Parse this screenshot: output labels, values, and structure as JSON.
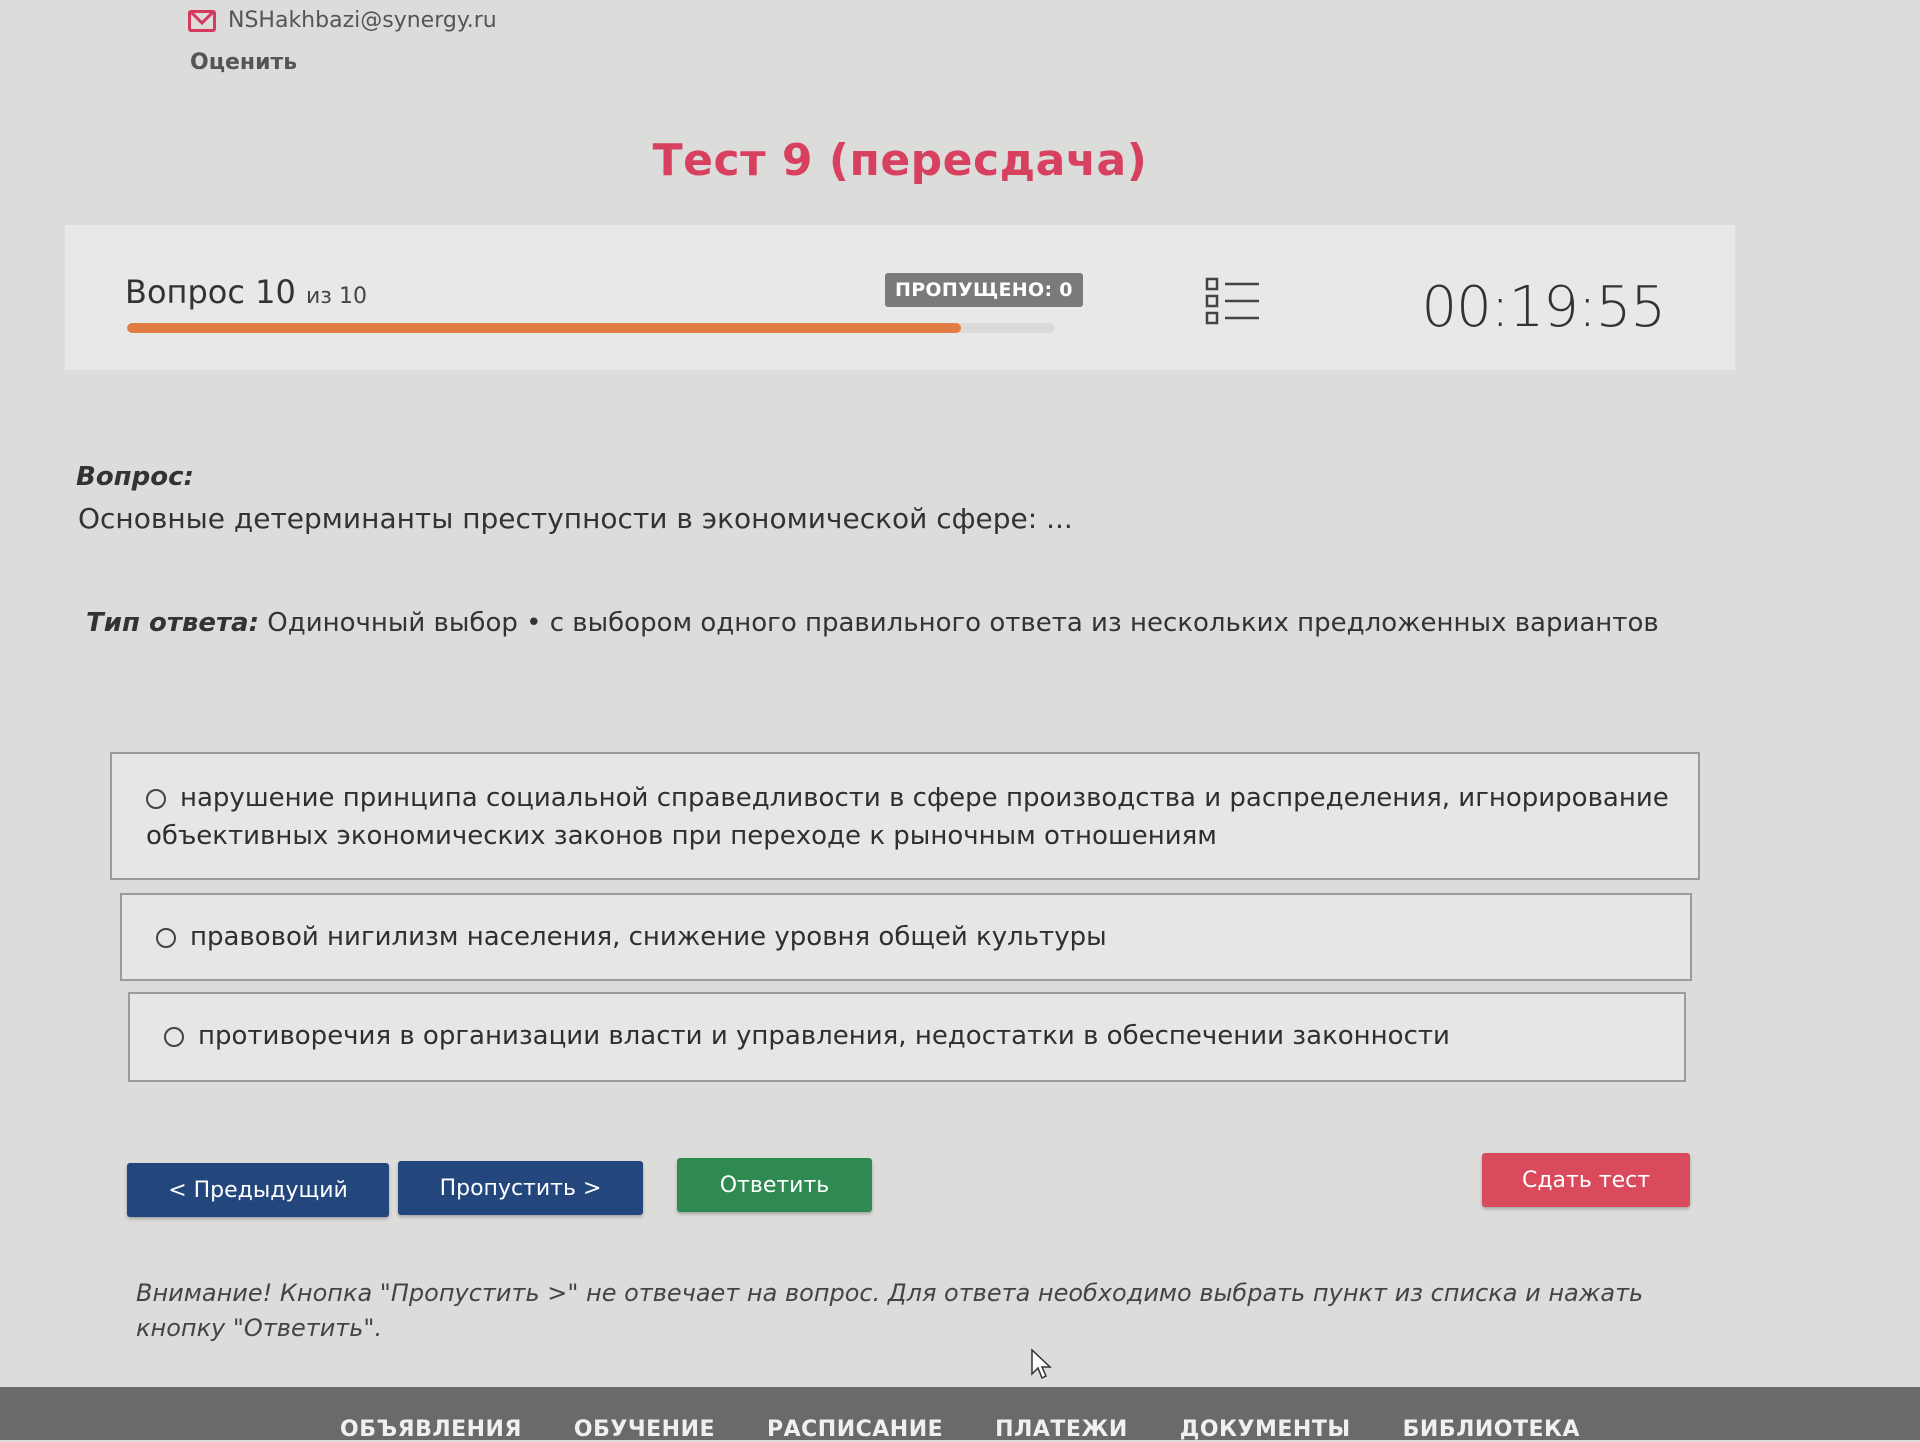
{
  "header": {
    "email": "NSHakhbazi@synergy.ru",
    "rate_label": "Оценить",
    "mail_icon": "mail-icon"
  },
  "title": "Тест 9 (пересдача)",
  "progress": {
    "question_label": "Вопрос",
    "current": "10",
    "of_label": "из 10",
    "skipped": "ПРОПУЩЕНО: 0",
    "fraction_complete": 0.9,
    "bar_color": "#e07d45",
    "list_icon": "question-list-icon",
    "timer": "00:19:55"
  },
  "question": {
    "label": "Вопрос:",
    "text": "Основные детерминанты преступности в экономической сфере: ...",
    "answer_type_label": "Тип ответа:",
    "answer_type_text": " Одиночный выбор • с выбором одного правильного ответа из нескольких предложенных вариантов"
  },
  "options": [
    "нарушение принципа социальной справедливости в сфере производства и распределения, игнорирование объективных экономических законов при переходе к рыночным отношениям",
    "правовой нигилизм населения, снижение уровня общей культуры",
    "противоречия в организации власти и управления, недостатки в обеспечении законности"
  ],
  "buttons": {
    "prev": "< Предыдущий",
    "skip": "Пропустить >",
    "answer": "Ответить",
    "submit": "Сдать тест"
  },
  "colors": {
    "title": "#d8405f",
    "nav_buttons": "#23467c",
    "answer_button": "#2e8a50",
    "submit_button": "#d84a5c"
  },
  "notice": "Внимание! Кнопка \"Пропустить >\" не отвечает на вопрос. Для ответа необходимо выбрать пункт из списка и нажать кнопку \"Ответить\".",
  "footer": {
    "items": [
      "ОБЪЯВЛЕНИЯ",
      "ОБУЧЕНИЕ",
      "РАСПИСАНИЕ",
      "ПЛАТЕЖИ",
      "ДОКУМЕНТЫ",
      "БИБЛИОТЕКА"
    ]
  }
}
